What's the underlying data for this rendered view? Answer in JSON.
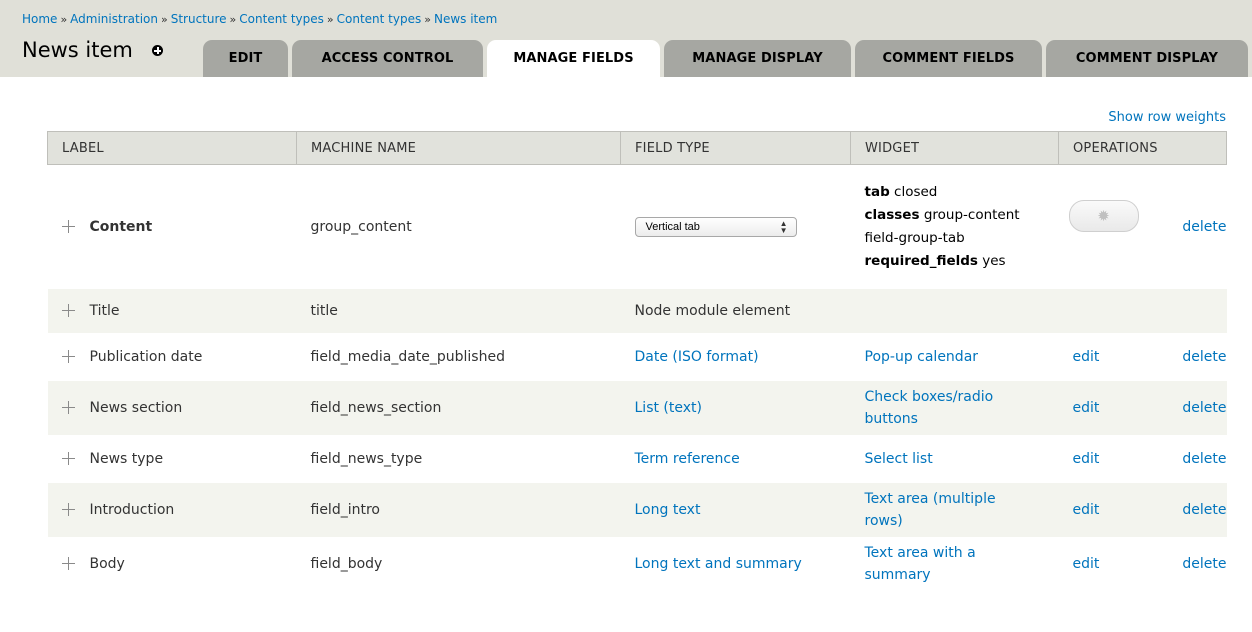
{
  "breadcrumb": [
    "Home",
    "Administration",
    "Structure",
    "Content types",
    "Content types",
    "News item"
  ],
  "breadcrumb_separator": "»",
  "page_title": "News item",
  "tabs": [
    {
      "label": "EDIT",
      "active": false
    },
    {
      "label": "ACCESS CONTROL",
      "active": false
    },
    {
      "label": "MANAGE FIELDS",
      "active": true
    },
    {
      "label": "MANAGE DISPLAY",
      "active": false
    },
    {
      "label": "COMMENT FIELDS",
      "active": false
    },
    {
      "label": "COMMENT DISPLAY",
      "active": false
    }
  ],
  "show_row_weights": "Show row weights",
  "table": {
    "headers": [
      "LABEL",
      "MACHINE NAME",
      "FIELD TYPE",
      "WIDGET",
      "OPERATIONS"
    ],
    "group_row": {
      "label": "Content",
      "machine_name": "group_content",
      "field_type_select": "Vertical tab",
      "widget_summary": [
        {
          "key": "tab",
          "value": "closed"
        },
        {
          "key": "classes",
          "value": "group-content"
        },
        {
          "key": "",
          "value": "field-group-tab"
        },
        {
          "key": "required_fields",
          "value": "yes"
        }
      ],
      "delete": "delete"
    },
    "rows": [
      {
        "label": "Title",
        "machine_name": "title",
        "field_type": "Node module element",
        "widget": "",
        "edit": "",
        "delete": ""
      },
      {
        "label": "Publication date",
        "machine_name": "field_media_date_published",
        "field_type": "Date (ISO format)",
        "widget": "Pop-up calendar",
        "edit": "edit",
        "delete": "delete"
      },
      {
        "label": "News section",
        "machine_name": "field_news_section",
        "field_type": "List (text)",
        "widget": "Check boxes/radio buttons",
        "edit": "edit",
        "delete": "delete"
      },
      {
        "label": "News type",
        "machine_name": "field_news_type",
        "field_type": "Term reference",
        "widget": "Select list",
        "edit": "edit",
        "delete": "delete"
      },
      {
        "label": "Introduction",
        "machine_name": "field_intro",
        "field_type": "Long text",
        "widget": "Text area (multiple rows)",
        "edit": "edit",
        "delete": "delete"
      },
      {
        "label": "Body",
        "machine_name": "field_body",
        "field_type": "Long text and summary",
        "widget": "Text area with a summary",
        "edit": "edit",
        "delete": "delete"
      }
    ]
  },
  "colors": {
    "link": "#0074bd",
    "header_bg": "#e0e0d8",
    "tab_bg": "#a6a7a2",
    "alt_row": "#f3f4ee"
  }
}
